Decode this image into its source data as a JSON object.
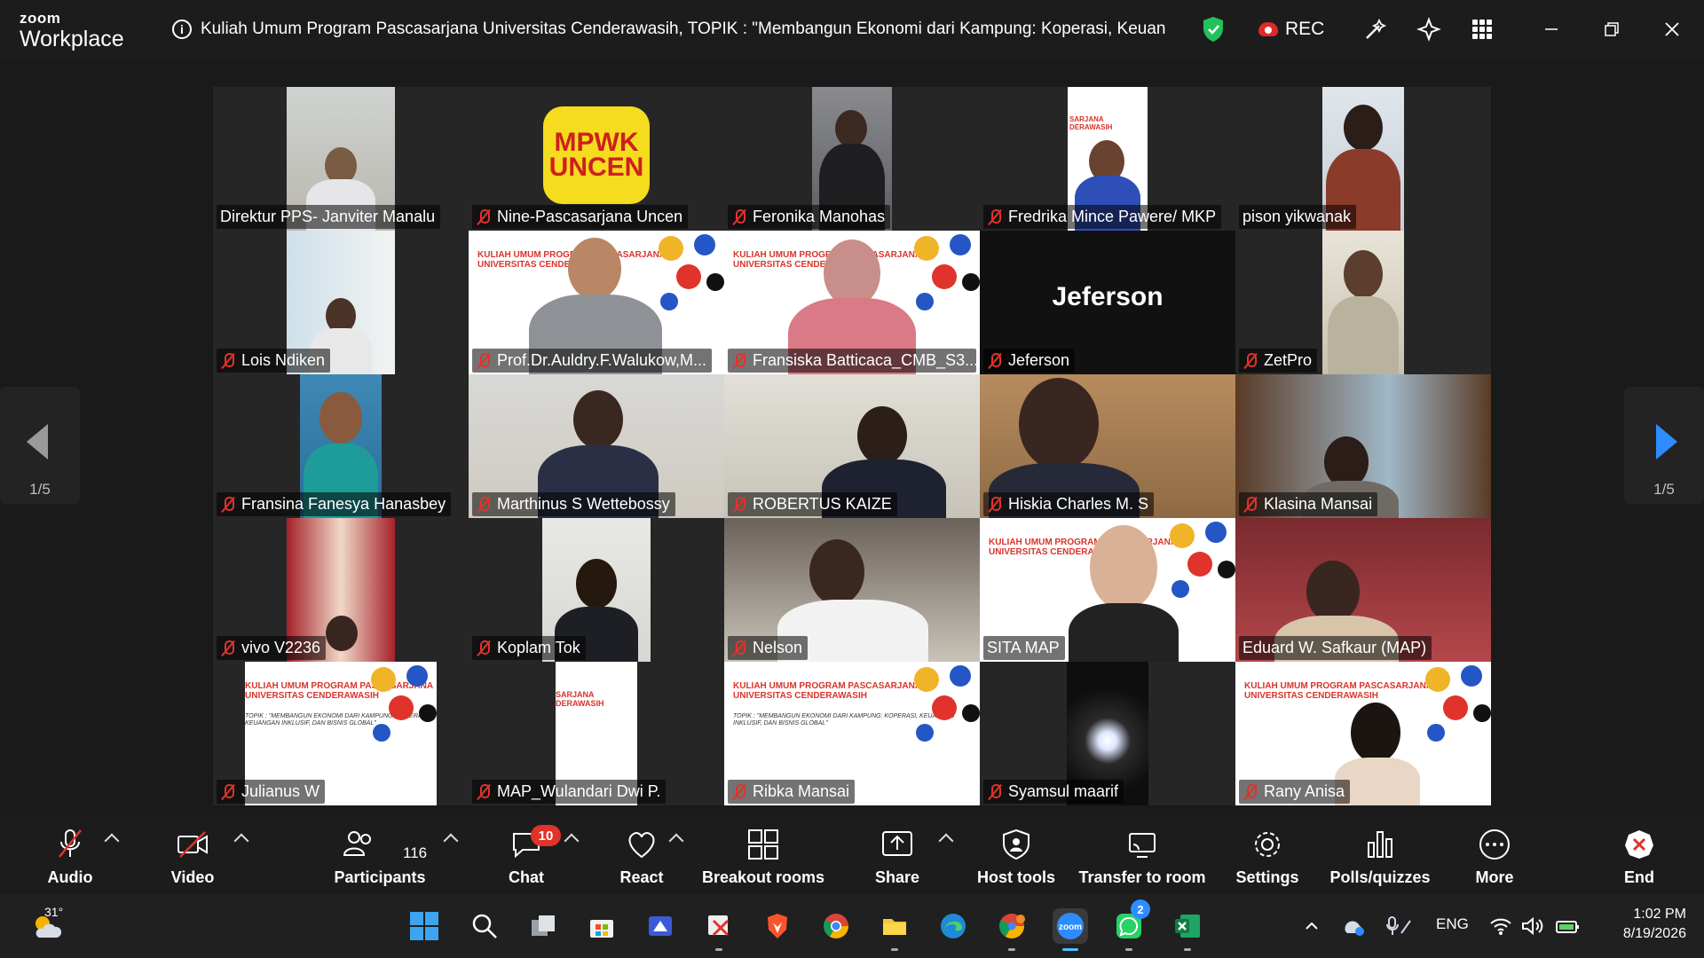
{
  "app": {
    "logo_line1": "zoom",
    "logo_line2": "Workplace",
    "meeting_title": "Kuliah Umum Program Pascasarjana Universitas Cenderawasih, TOPIK : \"Membangun Ekonomi dari Kampung: Koperasi, Keuangan Inklus",
    "rec_label": "REC"
  },
  "colors": {
    "accent": "#2d8cff",
    "rec": "#e02828",
    "active_speaker": "#2cd36b",
    "muted": "#e0332b"
  },
  "pagination": {
    "left": "1/5",
    "right": "1/5"
  },
  "slide_text": {
    "title": "KULIAH UMUM PROGRAM PASCASARJANA UNIVERSITAS CENDERAWASIH",
    "subtitle": "TOPIK : \"MEMBANGUN EKONOMI DARI KAMPUNG: KOPERASI, KEUANGAN INKLUSIF, DAN BISNIS GLOBAL\""
  },
  "tiles": [
    {
      "name": "Direktur PPS- Janviter Manalu",
      "muted": false
    },
    {
      "name": "Nine-Pascasarjana Uncen",
      "muted": true,
      "logo": "MPWK UNCEN"
    },
    {
      "name": "Feronika Manohas",
      "muted": true
    },
    {
      "name": "Fredrika Mince Pawere/ MKP",
      "muted": true
    },
    {
      "name": "pison yikwanak",
      "muted": false
    },
    {
      "name": "Lois Ndiken",
      "muted": true
    },
    {
      "name": "Prof.Dr.Auldry.F.Walukow,M...",
      "muted": true
    },
    {
      "name": "Fransiska Batticaca_CMB_S3...",
      "muted": true
    },
    {
      "name": "Jeferson",
      "muted": true,
      "center_label": "Jeferson"
    },
    {
      "name": "ZetPro",
      "muted": true
    },
    {
      "name": "Fransina Fanesya Hanasbey",
      "muted": true
    },
    {
      "name": "Marthinus S Wettebossy",
      "muted": true
    },
    {
      "name": "ROBERTUS KAIZE",
      "muted": true
    },
    {
      "name": "Hiskia Charles M. S",
      "muted": true
    },
    {
      "name": "Klasina Mansai",
      "muted": true
    },
    {
      "name": "vivo V2236",
      "muted": true
    },
    {
      "name": "Koplam Tok",
      "muted": true
    },
    {
      "name": "Nelson",
      "muted": true
    },
    {
      "name": "SITA MAP",
      "muted": false,
      "active": true
    },
    {
      "name": "Eduard W. Safkaur (MAP)",
      "muted": false
    },
    {
      "name": "Julianus W",
      "muted": true
    },
    {
      "name": "MAP_Wulandari Dwi P.",
      "muted": true
    },
    {
      "name": "Ribka Mansai",
      "muted": true
    },
    {
      "name": "Syamsul maarif",
      "muted": true
    },
    {
      "name": "Rany Anisa",
      "muted": true
    }
  ],
  "controls": {
    "audio": "Audio",
    "video": "Video",
    "participants": "Participants",
    "participants_count": "116",
    "chat": "Chat",
    "chat_badge": "10",
    "react": "React",
    "breakout": "Breakout rooms",
    "share": "Share",
    "host_tools": "Host tools",
    "transfer": "Transfer to room",
    "settings": "Settings",
    "polls": "Polls/quizzes",
    "more": "More",
    "end": "End"
  },
  "taskbar": {
    "weather_temp": "31°",
    "whatsapp_badge": "2",
    "lang": "ENG",
    "time": "1:02 PM",
    "date": "8/19/2026"
  }
}
